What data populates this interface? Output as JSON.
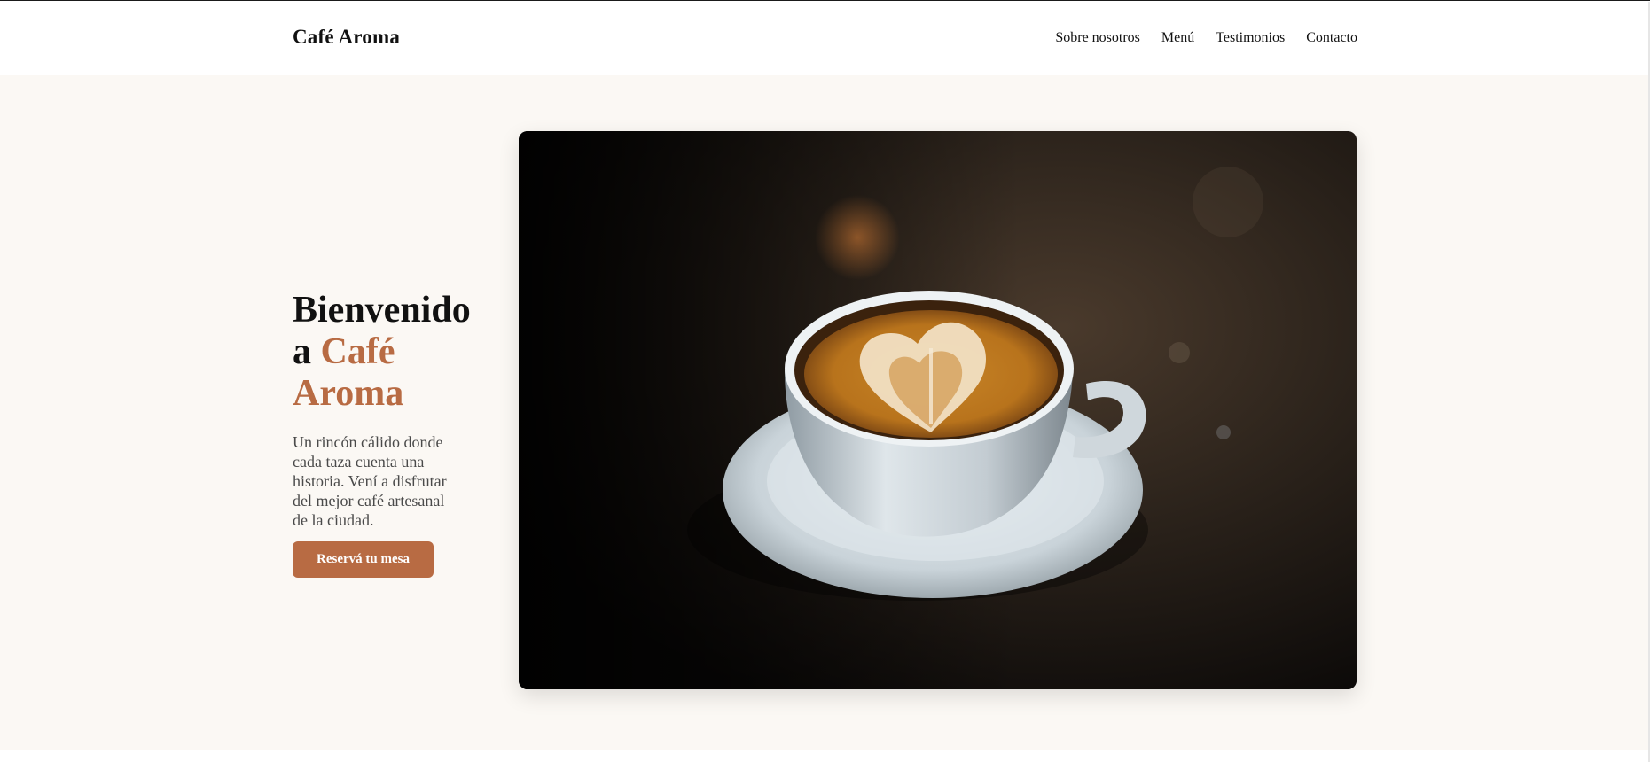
{
  "header": {
    "brand": "Café Aroma",
    "nav": [
      {
        "label": "Sobre nosotros"
      },
      {
        "label": "Menú"
      },
      {
        "label": "Testimonios"
      },
      {
        "label": "Contacto"
      }
    ]
  },
  "hero": {
    "title_prefix": "Bienvenido a ",
    "title_accent": "Café Aroma",
    "description": "Un rincón cálido donde cada taza cuenta una historia. Vení a disfrutar del mejor café artesanal de la ciudad.",
    "cta_label": "Reservá tu mesa",
    "image_subject": "latte-art-coffee-cup-photo"
  },
  "colors": {
    "accent": "#b86b43",
    "hero_background": "#fbf8f4",
    "header_background": "#ffffff",
    "text": "#111111",
    "muted_text": "#4a4a4a"
  }
}
